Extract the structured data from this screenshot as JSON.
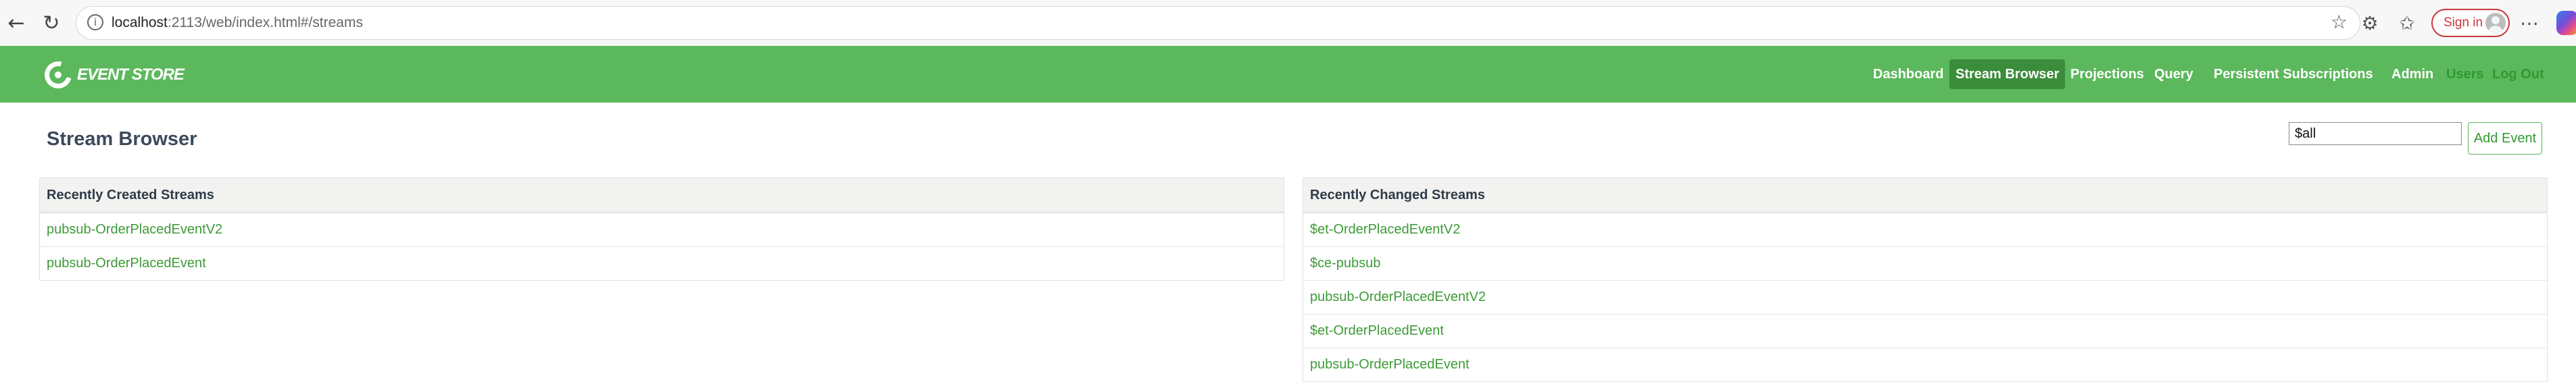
{
  "browser": {
    "url_host": "localhost",
    "url_rest": ":2113/web/index.html#/streams",
    "signin_label": "Sign in",
    "icons": {
      "back": "back-arrow-icon",
      "reload": "reload-icon",
      "info": "site-info-icon",
      "star": "star-icon",
      "extensions": "extensions-icon",
      "favorites": "favorites-icon",
      "menu": "more-menu-icon",
      "copilot": "copilot-icon"
    }
  },
  "app": {
    "logo_text": "EVENT STORE",
    "nav": [
      {
        "label": "Dashboard"
      },
      {
        "label": "Stream Browser",
        "active": true
      },
      {
        "label": "Projections"
      },
      {
        "label": "Query"
      },
      {
        "label": "Persistent Subscriptions"
      },
      {
        "label": "Admin"
      },
      {
        "label": "Users",
        "muted": true
      },
      {
        "label": "Log Out",
        "muted": true
      }
    ],
    "colors": {
      "header_bg": "#5cb85c",
      "active_nav_bg": "#3b8d3b",
      "link": "#3d9a37"
    }
  },
  "page": {
    "title": "Stream Browser",
    "search_value": "$all",
    "add_event_label": "Add Event"
  },
  "recently_created": {
    "title": "Recently Created Streams",
    "streams": [
      "pubsub-OrderPlacedEventV2",
      "pubsub-OrderPlacedEvent"
    ]
  },
  "recently_changed": {
    "title": "Recently Changed Streams",
    "streams": [
      "$et-OrderPlacedEventV2",
      "$ce-pubsub",
      "pubsub-OrderPlacedEventV2",
      "$et-OrderPlacedEvent",
      "pubsub-OrderPlacedEvent"
    ]
  }
}
